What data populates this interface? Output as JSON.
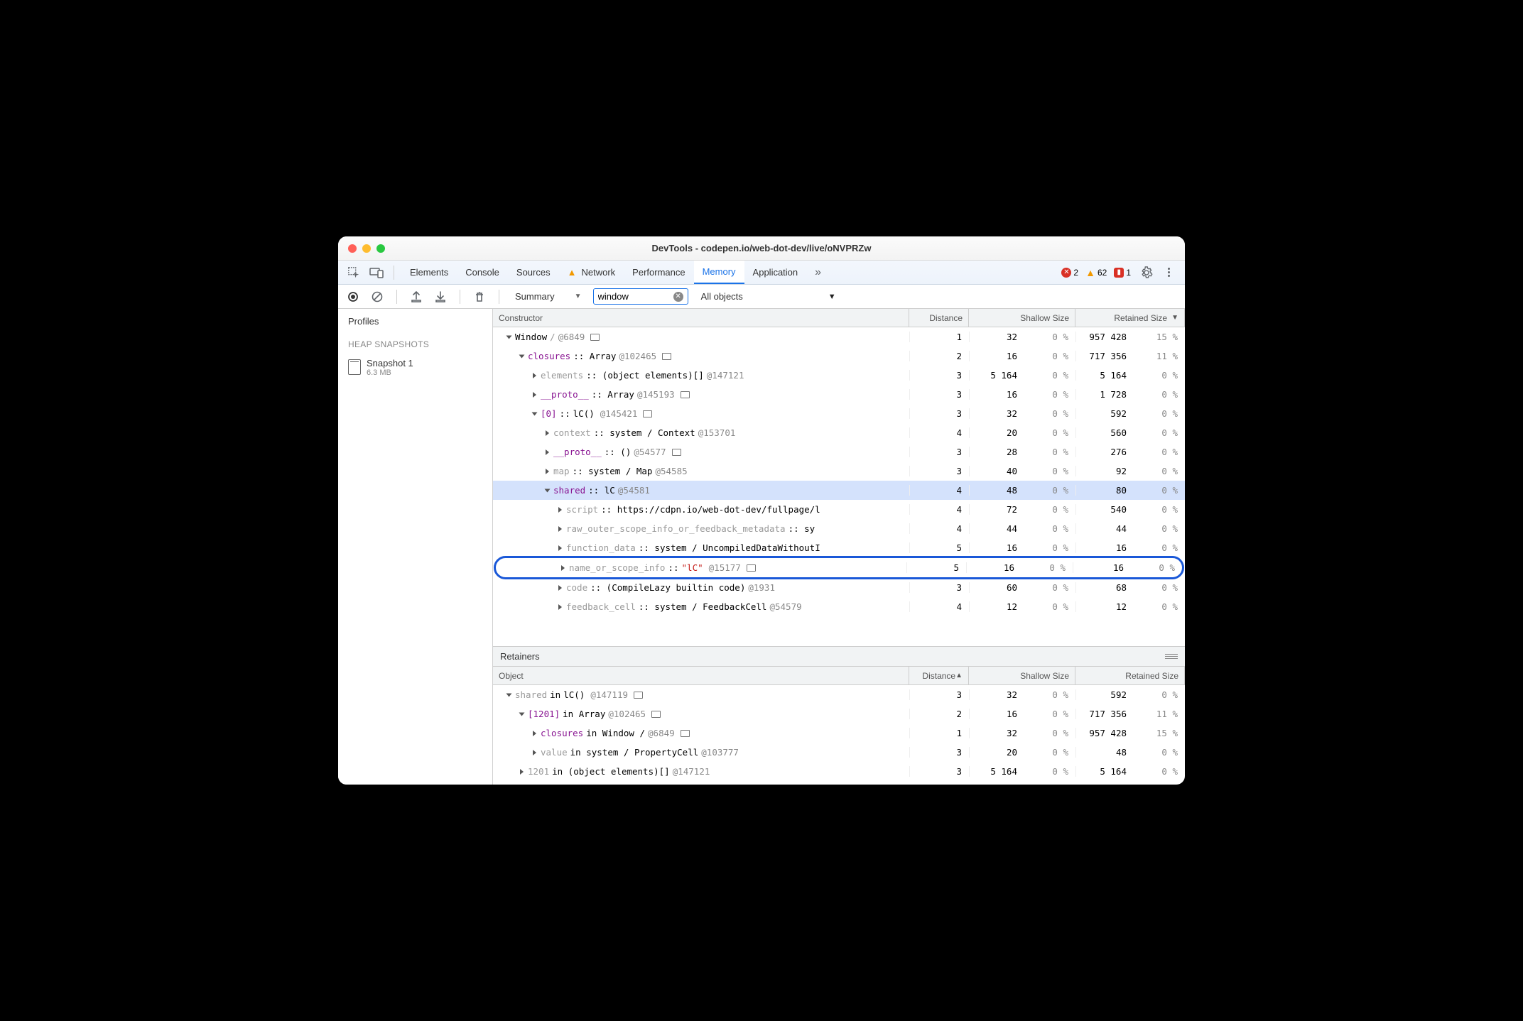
{
  "window": {
    "title": "DevTools - codepen.io/web-dot-dev/live/oNVPRZw"
  },
  "tabbar": {
    "tabs": [
      "Elements",
      "Console",
      "Sources",
      "Network",
      "Performance",
      "Memory",
      "Application"
    ],
    "active": "Memory",
    "warn_tab": "Network",
    "errors": {
      "red": "2",
      "yellow": "62",
      "square": "1"
    }
  },
  "toolbar": {
    "view": "Summary",
    "filter_value": "window",
    "object_filter": "All objects"
  },
  "left": {
    "profiles_label": "Profiles",
    "section": "HEAP SNAPSHOTS",
    "snapshot_name": "Snapshot 1",
    "snapshot_size": "6.3 MB"
  },
  "grid": {
    "headers": {
      "constructor": "Constructor",
      "distance": "Distance",
      "shallow": "Shallow Size",
      "retained": "Retained Size"
    }
  },
  "rows": [
    {
      "indent": 0,
      "open": true,
      "parts": [
        {
          "t": "Window",
          "c": ""
        },
        {
          "t": " /   ",
          "c": "grey"
        },
        {
          "t": "@6849",
          "c": "link"
        },
        {
          "box": true
        }
      ],
      "d": "1",
      "sv": "32",
      "sp": "0 %",
      "rv": "957 428",
      "rp": "15 %"
    },
    {
      "indent": 1,
      "open": true,
      "parts": [
        {
          "t": "closures",
          "c": "prop"
        },
        {
          "t": " :: Array ",
          "c": ""
        },
        {
          "t": "@102465",
          "c": "link"
        },
        {
          "box": true
        }
      ],
      "d": "2",
      "sv": "16",
      "sp": "0 %",
      "rv": "717 356",
      "rp": "11 %"
    },
    {
      "indent": 2,
      "open": false,
      "parts": [
        {
          "t": "elements",
          "c": "grey"
        },
        {
          "t": " :: (object elements)[] ",
          "c": ""
        },
        {
          "t": "@147121",
          "c": "link"
        }
      ],
      "d": "3",
      "sv": "5 164",
      "sp": "0 %",
      "rv": "5 164",
      "rp": "0 %"
    },
    {
      "indent": 2,
      "open": false,
      "parts": [
        {
          "t": "__proto__",
          "c": "prop"
        },
        {
          "t": " :: Array ",
          "c": ""
        },
        {
          "t": "@145193",
          "c": "link"
        },
        {
          "box": true
        }
      ],
      "d": "3",
      "sv": "16",
      "sp": "0 %",
      "rv": "1 728",
      "rp": "0 %"
    },
    {
      "indent": 2,
      "open": true,
      "parts": [
        {
          "t": "[0]",
          "c": "prop"
        },
        {
          "t": " :: ",
          "c": ""
        },
        {
          "t": "lC()",
          "c": ""
        },
        {
          "t": " ",
          "c": ""
        },
        {
          "t": "@145421",
          "c": "link"
        },
        {
          "box": true
        }
      ],
      "d": "3",
      "sv": "32",
      "sp": "0 %",
      "rv": "592",
      "rp": "0 %"
    },
    {
      "indent": 3,
      "open": false,
      "parts": [
        {
          "t": "context",
          "c": "grey"
        },
        {
          "t": " :: system / Context ",
          "c": ""
        },
        {
          "t": "@153701",
          "c": "link"
        }
      ],
      "d": "4",
      "sv": "20",
      "sp": "0 %",
      "rv": "560",
      "rp": "0 %"
    },
    {
      "indent": 3,
      "open": false,
      "parts": [
        {
          "t": "__proto__",
          "c": "prop"
        },
        {
          "t": " :: () ",
          "c": ""
        },
        {
          "t": "@54577",
          "c": "link"
        },
        {
          "box": true
        }
      ],
      "d": "3",
      "sv": "28",
      "sp": "0 %",
      "rv": "276",
      "rp": "0 %"
    },
    {
      "indent": 3,
      "open": false,
      "parts": [
        {
          "t": "map",
          "c": "grey"
        },
        {
          "t": " :: system / Map ",
          "c": ""
        },
        {
          "t": "@54585",
          "c": "link"
        }
      ],
      "d": "3",
      "sv": "40",
      "sp": "0 %",
      "rv": "92",
      "rp": "0 %"
    },
    {
      "indent": 3,
      "open": true,
      "selected": true,
      "parts": [
        {
          "t": "shared",
          "c": "prop"
        },
        {
          "t": " :: lC ",
          "c": ""
        },
        {
          "t": "@54581",
          "c": "link"
        }
      ],
      "d": "4",
      "sv": "48",
      "sp": "0 %",
      "rv": "80",
      "rp": "0 %"
    },
    {
      "indent": 4,
      "open": false,
      "parts": [
        {
          "t": "script",
          "c": "grey"
        },
        {
          "t": " :: https://cdpn.io/web-dot-dev/fullpage/l",
          "c": ""
        }
      ],
      "d": "4",
      "sv": "72",
      "sp": "0 %",
      "rv": "540",
      "rp": "0 %"
    },
    {
      "indent": 4,
      "open": false,
      "parts": [
        {
          "t": "raw_outer_scope_info_or_feedback_metadata",
          "c": "grey"
        },
        {
          "t": " :: sy",
          "c": ""
        }
      ],
      "d": "4",
      "sv": "44",
      "sp": "0 %",
      "rv": "44",
      "rp": "0 %"
    },
    {
      "indent": 4,
      "open": false,
      "parts": [
        {
          "t": "function_data",
          "c": "grey"
        },
        {
          "t": " :: system / UncompiledDataWithoutI",
          "c": ""
        }
      ],
      "d": "5",
      "sv": "16",
      "sp": "0 %",
      "rv": "16",
      "rp": "0 %"
    },
    {
      "indent": 4,
      "open": false,
      "hl": true,
      "parts": [
        {
          "t": "name_or_scope_info",
          "c": "grey"
        },
        {
          "t": " :: ",
          "c": ""
        },
        {
          "t": "\"lC\"",
          "c": "redstr"
        },
        {
          "t": " ",
          "c": ""
        },
        {
          "t": "@15177",
          "c": "link"
        },
        {
          "box": true
        }
      ],
      "d": "5",
      "sv": "16",
      "sp": "0 %",
      "rv": "16",
      "rp": "0 %"
    },
    {
      "indent": 4,
      "open": false,
      "parts": [
        {
          "t": "code",
          "c": "grey"
        },
        {
          "t": " :: (CompileLazy builtin code) ",
          "c": ""
        },
        {
          "t": "@1931",
          "c": "link"
        }
      ],
      "d": "3",
      "sv": "60",
      "sp": "0 %",
      "rv": "68",
      "rp": "0 %"
    },
    {
      "indent": 4,
      "open": false,
      "parts": [
        {
          "t": "feedback_cell",
          "c": "grey"
        },
        {
          "t": " :: system / FeedbackCell ",
          "c": ""
        },
        {
          "t": "@54579",
          "c": "link"
        }
      ],
      "d": "4",
      "sv": "12",
      "sp": "0 %",
      "rv": "12",
      "rp": "0 %"
    }
  ],
  "retainers": {
    "label": "Retainers",
    "headers": {
      "object": "Object",
      "distance": "Distance",
      "shallow": "Shallow Size",
      "retained": "Retained Size"
    },
    "rows": [
      {
        "indent": 0,
        "open": true,
        "parts": [
          {
            "t": "shared",
            "c": "grey"
          },
          {
            "t": " in ",
            "c": ""
          },
          {
            "t": "lC()",
            "c": ""
          },
          {
            "t": " ",
            "c": ""
          },
          {
            "t": "@147119",
            "c": "link"
          },
          {
            "box": true
          }
        ],
        "d": "3",
        "sv": "32",
        "sp": "0 %",
        "rv": "592",
        "rp": "0 %"
      },
      {
        "indent": 1,
        "open": true,
        "parts": [
          {
            "t": "[1201]",
            "c": "prop"
          },
          {
            "t": " in Array ",
            "c": ""
          },
          {
            "t": "@102465",
            "c": "link"
          },
          {
            "box": true
          }
        ],
        "d": "2",
        "sv": "16",
        "sp": "0 %",
        "rv": "717 356",
        "rp": "11 %"
      },
      {
        "indent": 2,
        "open": false,
        "parts": [
          {
            "t": "closures",
            "c": "prop"
          },
          {
            "t": " in Window /   ",
            "c": ""
          },
          {
            "t": "@6849",
            "c": "link"
          },
          {
            "box": true
          }
        ],
        "d": "1",
        "sv": "32",
        "sp": "0 %",
        "rv": "957 428",
        "rp": "15 %"
      },
      {
        "indent": 2,
        "open": false,
        "parts": [
          {
            "t": "value",
            "c": "grey"
          },
          {
            "t": " in system / PropertyCell ",
            "c": ""
          },
          {
            "t": "@103777",
            "c": "link"
          }
        ],
        "d": "3",
        "sv": "20",
        "sp": "0 %",
        "rv": "48",
        "rp": "0 %"
      },
      {
        "indent": 1,
        "open": false,
        "parts": [
          {
            "t": "1201",
            "c": "grey"
          },
          {
            "t": " in (object elements)[] ",
            "c": ""
          },
          {
            "t": "@147121",
            "c": "link"
          }
        ],
        "d": "3",
        "sv": "5 164",
        "sp": "0 %",
        "rv": "5 164",
        "rp": "0 %"
      }
    ]
  }
}
